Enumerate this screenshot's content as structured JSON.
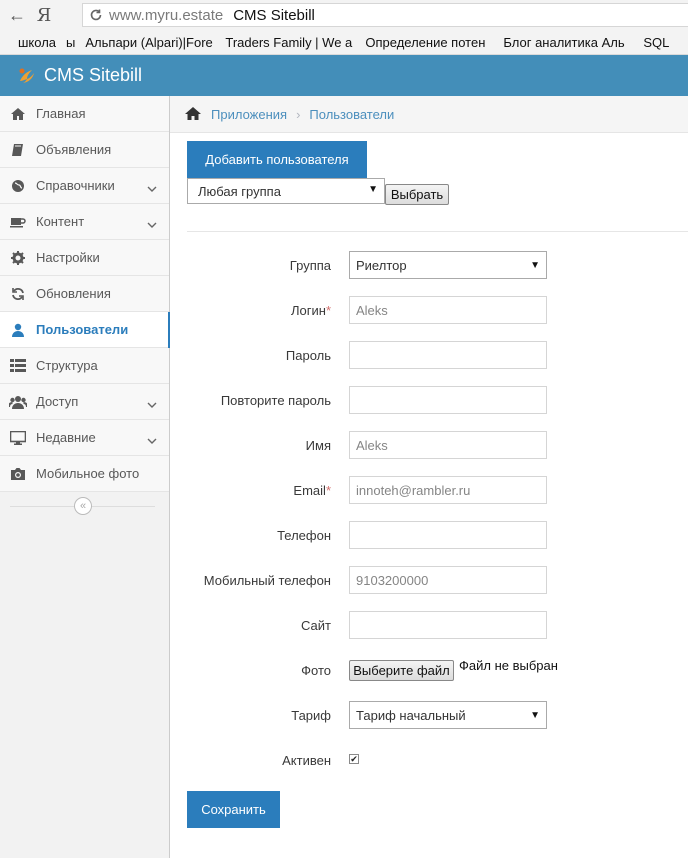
{
  "browser": {
    "back_glyph": "←",
    "yandex_glyph": "Я",
    "url_domain": "www.myru.estate",
    "page_title": "CMS Sitebill",
    "bookmarks": [
      "школа",
      "ы",
      "Альпари (Alpari)|Fore",
      "Traders Family | We a",
      "Определение потен",
      "Блог аналитика Аль",
      "SQL"
    ]
  },
  "header": {
    "brand": "CMS Sitebill",
    "accent": "#438eb9"
  },
  "sidebar": {
    "items": [
      {
        "label": "Главная",
        "icon": "home-icon"
      },
      {
        "label": "Объявления",
        "icon": "book-icon"
      },
      {
        "label": "Справочники",
        "icon": "globe-icon"
      },
      {
        "label": "Контент",
        "icon": "coffee-icon"
      },
      {
        "label": "Настройки",
        "icon": "gear-icon"
      },
      {
        "label": "Обновления",
        "icon": "refresh-icon"
      },
      {
        "label": "Пользователи",
        "icon": "user-icon"
      },
      {
        "label": "Структура",
        "icon": "list-icon"
      },
      {
        "label": "Доступ",
        "icon": "users-icon"
      },
      {
        "label": "Недавние",
        "icon": "desktop-icon"
      },
      {
        "label": "Мобильное фото",
        "icon": "camera-icon"
      }
    ],
    "collapse_glyph": "«"
  },
  "breadcrumbs": {
    "items": [
      "Приложения",
      "Пользователи"
    ],
    "separator": "›"
  },
  "toolbar": {
    "add_user_label": "Добавить пользователя",
    "group_filter_value": "Любая группа",
    "choose_label": "Выбрать"
  },
  "form": {
    "group_label": "Группа",
    "group_value": "Риелтор",
    "login_label": "Логин",
    "login_value": "Aleks",
    "required_mark": "*",
    "password_label": "Пароль",
    "password_value": "",
    "password_repeat_label": "Повторите пароль",
    "password_repeat_value": "",
    "name_label": "Имя",
    "name_value": "Aleks",
    "email_label": "Email",
    "email_value": "innoteh@rambler.ru",
    "phone_label": "Телефон",
    "phone_value": "",
    "mobile_label": "Мобильный телефон",
    "mobile_value": "9103200000",
    "site_label": "Сайт",
    "site_value": "",
    "photo_label": "Фото",
    "file_button_label": "Выберите файл",
    "file_status": "Файл не выбран",
    "tariff_label": "Тариф",
    "tariff_value": "Тариф начальный",
    "active_label": "Активен",
    "active_checked": true,
    "check_glyph": "✔",
    "save_label": "Сохранить",
    "select_arrow": "▼"
  }
}
